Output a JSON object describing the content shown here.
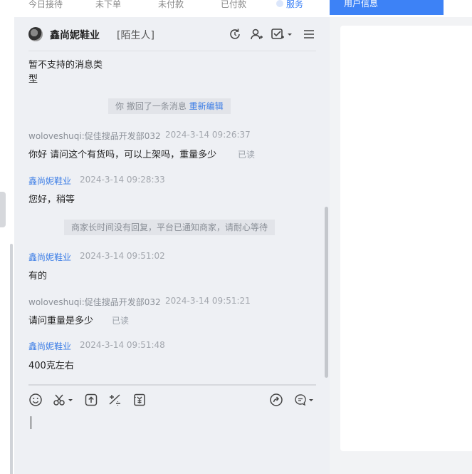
{
  "top_tabs": [
    "今日接待",
    "未下单",
    "未付款",
    "已付款",
    "服务"
  ],
  "right_panel": {
    "active_tab": "用户信息"
  },
  "header": {
    "shop_name": "鑫尚妮鞋业",
    "tag": "[陌生人]"
  },
  "messages": {
    "unsupported_1": "暂不支持的消息类",
    "unsupported_2": "型",
    "recall_text": "你 撤回了一条消息",
    "recall_link": "重新编辑",
    "m1_sender": "woloveshuqi:促佳搜品开发部032",
    "m1_time": "2024-3-14 09:26:37",
    "m1_text": "你好 请问这个有货吗，可以上架吗，重量多少",
    "m1_status": "已读",
    "m2_sender": "鑫尚妮鞋业",
    "m2_time": "2024-3-14 09:28:33",
    "m2_text": "您好，稍等",
    "system_notice": "商家长时间没有回复，平台已通知商家，请耐心等待",
    "m3_sender": "鑫尚妮鞋业",
    "m3_time": "2024-3-14 09:51:02",
    "m3_text": "有的",
    "m4_sender": "woloveshuqi:促佳搜品开发部032",
    "m4_time": "2024-3-14 09:51:21",
    "m4_text": "请问重量是多少",
    "m4_status": "已读",
    "m5_sender": "鑫尚妮鞋业",
    "m5_time": "2024-3-14 09:51:48",
    "m5_text": "400克左右"
  },
  "colors": {
    "accent": "#3d82f6",
    "chat_bg": "#eef0f4",
    "link": "#3d7ee6"
  },
  "icons": {
    "header": [
      "refresh-icon",
      "user-icon",
      "checklist-icon",
      "menu-icon"
    ],
    "toolbar": [
      "emoji-icon",
      "scissors-icon",
      "upload-icon",
      "calculator-icon",
      "coupon-icon",
      "share-icon",
      "quick-reply-icon"
    ]
  }
}
